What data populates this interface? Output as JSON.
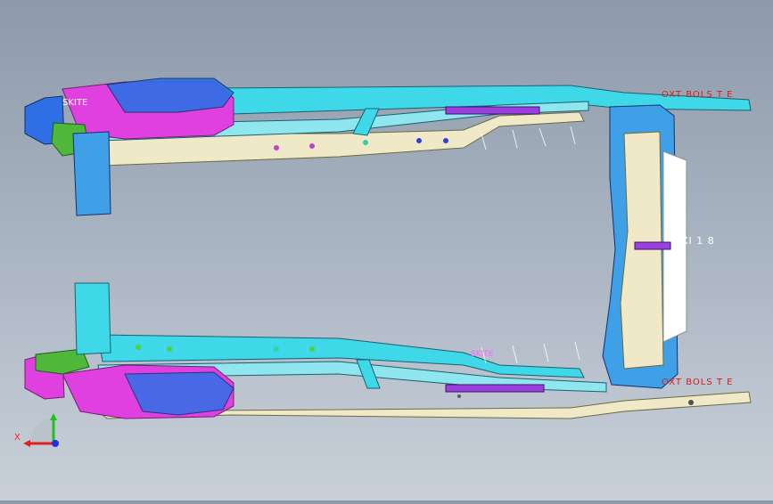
{
  "viewport": {
    "background_top": "#8e9aaa",
    "background_bottom": "#c9d0d9"
  },
  "labels": {
    "top_right": "OXT BOLS T E",
    "bottom_right": "OXT BOLS T E",
    "middle_right": "XI 1 8",
    "top_left": "SKITE",
    "bottom_mid": "SKITE"
  },
  "axis_triad": {
    "x_label": "X",
    "x_color": "#e02020",
    "y_color": "#20c020",
    "z_color": "#2030e0"
  },
  "colors": {
    "cyan": "#3fd8e8",
    "blue": "#2e6fe6",
    "magenta": "#e040e0",
    "green": "#4fb83a",
    "cream": "#efe9c8",
    "purple": "#9a40e0"
  }
}
